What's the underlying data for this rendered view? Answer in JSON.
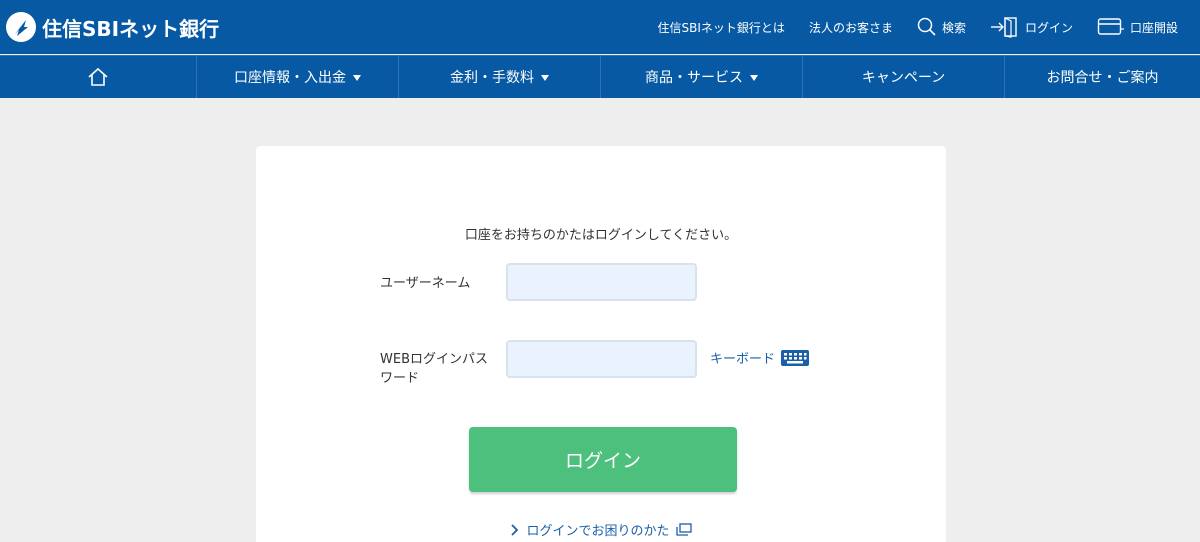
{
  "header": {
    "logo_text": "住信SBIネット銀行",
    "links": {
      "about": "住信SBIネット銀行とは",
      "corporate": "法人のお客さま",
      "search": "検索",
      "login": "ログイン",
      "open_account": "口座開設"
    }
  },
  "nav": {
    "home_icon": "home-icon",
    "items": [
      {
        "label": "口座情報・入出金",
        "has_dropdown": true
      },
      {
        "label": "金利・手数料",
        "has_dropdown": true
      },
      {
        "label": "商品・サービス",
        "has_dropdown": true
      },
      {
        "label": "キャンペーン",
        "has_dropdown": false
      },
      {
        "label": "お問合せ・ご案内",
        "has_dropdown": false
      }
    ]
  },
  "login_form": {
    "intro": "口座をお持ちのかたはログインしてください。",
    "username_label": "ユーザーネーム",
    "username_value": "",
    "password_label": "WEBログインパスワード",
    "password_value": "",
    "keyboard_link": "キーボード",
    "submit_label": "ログイン",
    "help_link": "ログインでお困りのかた"
  },
  "colors": {
    "brand_blue": "#0759a4",
    "page_bg": "#eeeeee",
    "input_bg": "#eaf2fd",
    "login_green": "#4dc07e",
    "link_blue": "#1a5fa8"
  }
}
